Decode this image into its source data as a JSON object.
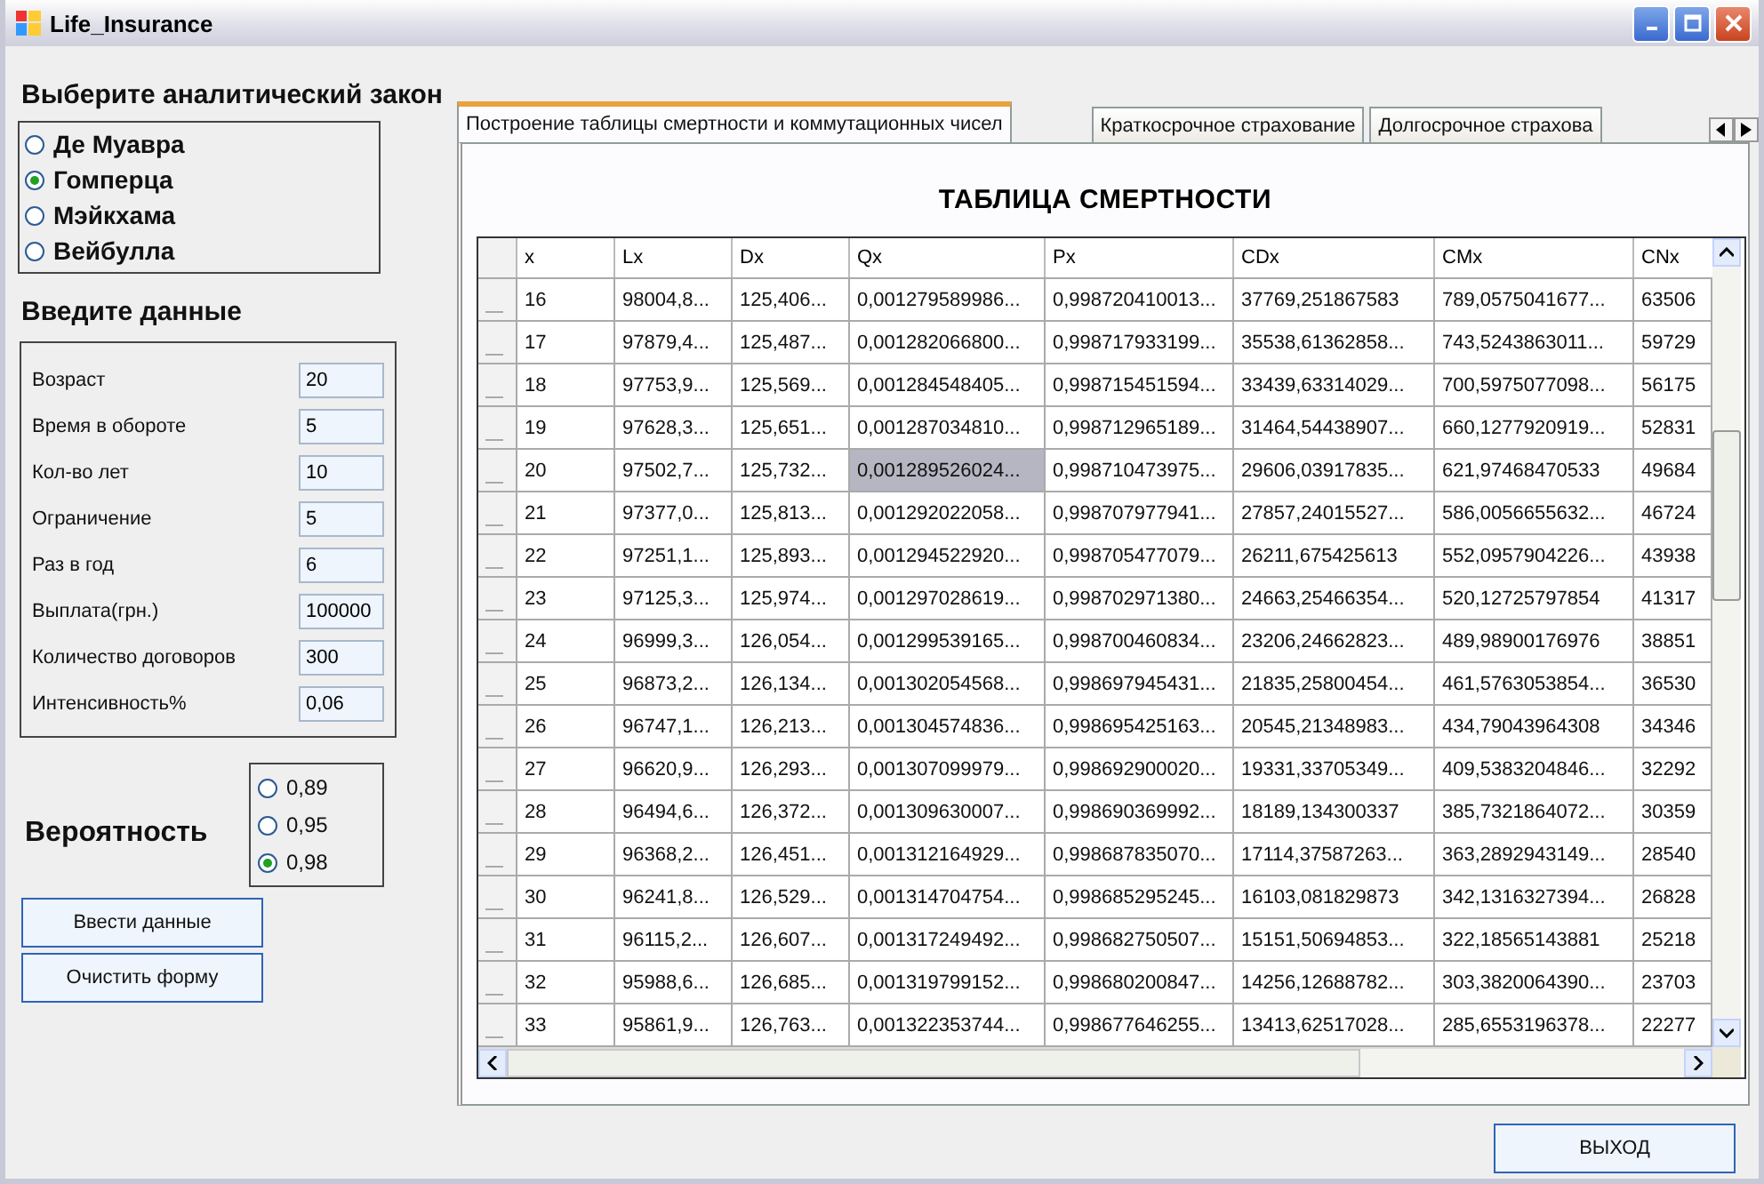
{
  "window": {
    "title": "Life_Insurance"
  },
  "law": {
    "heading": "Выберите аналитический закон",
    "options": [
      {
        "label": "Де Муавра",
        "selected": false
      },
      {
        "label": "Гомперца",
        "selected": true
      },
      {
        "label": "Мэйкхама",
        "selected": false
      },
      {
        "label": "Вейбулла",
        "selected": false
      }
    ]
  },
  "inputs": {
    "heading": "Введите данные",
    "fields": [
      {
        "label": "Возраст",
        "value": "20"
      },
      {
        "label": "Время в обороте",
        "value": "5"
      },
      {
        "label": "Кол-во лет",
        "value": "10"
      },
      {
        "label": "Ограничение",
        "value": "5"
      },
      {
        "label": "Раз в год",
        "value": "6"
      },
      {
        "label": "Выплата(грн.)",
        "value": "100000"
      },
      {
        "label": "Количество договоров",
        "value": "300"
      },
      {
        "label": "Интенсивность%",
        "value": "0,06"
      }
    ]
  },
  "probability": {
    "label": "Вероятность",
    "options": [
      {
        "label": "0,89",
        "selected": false
      },
      {
        "label": "0,95",
        "selected": false
      },
      {
        "label": "0,98",
        "selected": true
      }
    ]
  },
  "buttons": [
    "Ввести данные",
    "Очистить форму"
  ],
  "tabs": [
    {
      "label": "Построение таблицы смертности и коммутационных чисел",
      "selected": true
    },
    {
      "label": "Краткосрочное страхование",
      "selected": false
    },
    {
      "label": "Долгосрочное страхова",
      "selected": false
    }
  ],
  "table": {
    "title": "ТАБЛИЦА СМЕРТНОСТИ",
    "columns": [
      "x",
      "Lx",
      "Dx",
      "Qx",
      "Px",
      "CDx",
      "CMx",
      "CNx"
    ],
    "rows": [
      {
        "cells": [
          {
            "text": "16",
            "selected": false
          },
          {
            "text": "98004,8...",
            "selected": false
          },
          {
            "text": "125,406...",
            "selected": false
          },
          {
            "text": "0,001279589986...",
            "selected": false
          },
          {
            "text": "0,998720410013...",
            "selected": false
          },
          {
            "text": "37769,251867583",
            "selected": false
          },
          {
            "text": "789,0575041677...",
            "selected": false
          },
          {
            "text": "63506",
            "selected": false
          }
        ]
      },
      {
        "cells": [
          {
            "text": "17",
            "selected": false
          },
          {
            "text": "97879,4...",
            "selected": false
          },
          {
            "text": "125,487...",
            "selected": false
          },
          {
            "text": "0,001282066800...",
            "selected": false
          },
          {
            "text": "0,998717933199...",
            "selected": false
          },
          {
            "text": "35538,61362858...",
            "selected": false
          },
          {
            "text": "743,5243863011...",
            "selected": false
          },
          {
            "text": "59729",
            "selected": false
          }
        ]
      },
      {
        "cells": [
          {
            "text": "18",
            "selected": false
          },
          {
            "text": "97753,9...",
            "selected": false
          },
          {
            "text": "125,569...",
            "selected": false
          },
          {
            "text": "0,001284548405...",
            "selected": false
          },
          {
            "text": "0,998715451594...",
            "selected": false
          },
          {
            "text": "33439,63314029...",
            "selected": false
          },
          {
            "text": "700,5975077098...",
            "selected": false
          },
          {
            "text": "56175",
            "selected": false
          }
        ]
      },
      {
        "cells": [
          {
            "text": "19",
            "selected": false
          },
          {
            "text": "97628,3...",
            "selected": false
          },
          {
            "text": "125,651...",
            "selected": false
          },
          {
            "text": "0,001287034810...",
            "selected": false
          },
          {
            "text": "0,998712965189...",
            "selected": false
          },
          {
            "text": "31464,54438907...",
            "selected": false
          },
          {
            "text": "660,1277920919...",
            "selected": false
          },
          {
            "text": "52831",
            "selected": false
          }
        ]
      },
      {
        "cells": [
          {
            "text": "20",
            "selected": false
          },
          {
            "text": "97502,7...",
            "selected": false
          },
          {
            "text": "125,732...",
            "selected": false
          },
          {
            "text": "0,001289526024...",
            "selected": true
          },
          {
            "text": "0,998710473975...",
            "selected": false
          },
          {
            "text": "29606,03917835...",
            "selected": false
          },
          {
            "text": "621,97468470533",
            "selected": false
          },
          {
            "text": "49684",
            "selected": false
          }
        ]
      },
      {
        "cells": [
          {
            "text": "21",
            "selected": false
          },
          {
            "text": "97377,0...",
            "selected": false
          },
          {
            "text": "125,813...",
            "selected": false
          },
          {
            "text": "0,001292022058...",
            "selected": false
          },
          {
            "text": "0,998707977941...",
            "selected": false
          },
          {
            "text": "27857,24015527...",
            "selected": false
          },
          {
            "text": "586,0056655632...",
            "selected": false
          },
          {
            "text": "46724",
            "selected": false
          }
        ]
      },
      {
        "cells": [
          {
            "text": "22",
            "selected": false
          },
          {
            "text": "97251,1...",
            "selected": false
          },
          {
            "text": "125,893...",
            "selected": false
          },
          {
            "text": "0,001294522920...",
            "selected": false
          },
          {
            "text": "0,998705477079...",
            "selected": false
          },
          {
            "text": "26211,675425613",
            "selected": false
          },
          {
            "text": "552,0957904226...",
            "selected": false
          },
          {
            "text": "43938",
            "selected": false
          }
        ]
      },
      {
        "cells": [
          {
            "text": "23",
            "selected": false
          },
          {
            "text": "97125,3...",
            "selected": false
          },
          {
            "text": "125,974...",
            "selected": false
          },
          {
            "text": "0,001297028619...",
            "selected": false
          },
          {
            "text": "0,998702971380...",
            "selected": false
          },
          {
            "text": "24663,25466354...",
            "selected": false
          },
          {
            "text": "520,12725797854",
            "selected": false
          },
          {
            "text": "41317",
            "selected": false
          }
        ]
      },
      {
        "cells": [
          {
            "text": "24",
            "selected": false
          },
          {
            "text": "96999,3...",
            "selected": false
          },
          {
            "text": "126,054...",
            "selected": false
          },
          {
            "text": "0,001299539165...",
            "selected": false
          },
          {
            "text": "0,998700460834...",
            "selected": false
          },
          {
            "text": "23206,24662823...",
            "selected": false
          },
          {
            "text": "489,98900176976",
            "selected": false
          },
          {
            "text": "38851",
            "selected": false
          }
        ]
      },
      {
        "cells": [
          {
            "text": "25",
            "selected": false
          },
          {
            "text": "96873,2...",
            "selected": false
          },
          {
            "text": "126,134...",
            "selected": false
          },
          {
            "text": "0,001302054568...",
            "selected": false
          },
          {
            "text": "0,998697945431...",
            "selected": false
          },
          {
            "text": "21835,25800454...",
            "selected": false
          },
          {
            "text": "461,5763053854...",
            "selected": false
          },
          {
            "text": "36530",
            "selected": false
          }
        ]
      },
      {
        "cells": [
          {
            "text": "26",
            "selected": false
          },
          {
            "text": "96747,1...",
            "selected": false
          },
          {
            "text": "126,213...",
            "selected": false
          },
          {
            "text": "0,001304574836...",
            "selected": false
          },
          {
            "text": "0,998695425163...",
            "selected": false
          },
          {
            "text": "20545,21348983...",
            "selected": false
          },
          {
            "text": "434,79043964308",
            "selected": false
          },
          {
            "text": "34346",
            "selected": false
          }
        ]
      },
      {
        "cells": [
          {
            "text": "27",
            "selected": false
          },
          {
            "text": "96620,9...",
            "selected": false
          },
          {
            "text": "126,293...",
            "selected": false
          },
          {
            "text": "0,001307099979...",
            "selected": false
          },
          {
            "text": "0,998692900020...",
            "selected": false
          },
          {
            "text": "19331,33705349...",
            "selected": false
          },
          {
            "text": "409,5383204846...",
            "selected": false
          },
          {
            "text": "32292",
            "selected": false
          }
        ]
      },
      {
        "cells": [
          {
            "text": "28",
            "selected": false
          },
          {
            "text": "96494,6...",
            "selected": false
          },
          {
            "text": "126,372...",
            "selected": false
          },
          {
            "text": "0,001309630007...",
            "selected": false
          },
          {
            "text": "0,998690369992...",
            "selected": false
          },
          {
            "text": "18189,134300337",
            "selected": false
          },
          {
            "text": "385,7321864072...",
            "selected": false
          },
          {
            "text": "30359",
            "selected": false
          }
        ]
      },
      {
        "cells": [
          {
            "text": "29",
            "selected": false
          },
          {
            "text": "96368,2...",
            "selected": false
          },
          {
            "text": "126,451...",
            "selected": false
          },
          {
            "text": "0,001312164929...",
            "selected": false
          },
          {
            "text": "0,998687835070...",
            "selected": false
          },
          {
            "text": "17114,37587263...",
            "selected": false
          },
          {
            "text": "363,2892943149...",
            "selected": false
          },
          {
            "text": "28540",
            "selected": false
          }
        ]
      },
      {
        "cells": [
          {
            "text": "30",
            "selected": false
          },
          {
            "text": "96241,8...",
            "selected": false
          },
          {
            "text": "126,529...",
            "selected": false
          },
          {
            "text": "0,001314704754...",
            "selected": false
          },
          {
            "text": "0,998685295245...",
            "selected": false
          },
          {
            "text": "16103,081829873",
            "selected": false
          },
          {
            "text": "342,1316327394...",
            "selected": false
          },
          {
            "text": "26828",
            "selected": false
          }
        ]
      },
      {
        "cells": [
          {
            "text": "31",
            "selected": false
          },
          {
            "text": "96115,2...",
            "selected": false
          },
          {
            "text": "126,607...",
            "selected": false
          },
          {
            "text": "0,001317249492...",
            "selected": false
          },
          {
            "text": "0,998682750507...",
            "selected": false
          },
          {
            "text": "15151,50694853...",
            "selected": false
          },
          {
            "text": "322,18565143881",
            "selected": false
          },
          {
            "text": "25218",
            "selected": false
          }
        ]
      },
      {
        "cells": [
          {
            "text": "32",
            "selected": false
          },
          {
            "text": "95988,6...",
            "selected": false
          },
          {
            "text": "126,685...",
            "selected": false
          },
          {
            "text": "0,001319799152...",
            "selected": false
          },
          {
            "text": "0,998680200847...",
            "selected": false
          },
          {
            "text": "14256,12688782...",
            "selected": false
          },
          {
            "text": "303,3820064390...",
            "selected": false
          },
          {
            "text": "23703",
            "selected": false
          }
        ]
      },
      {
        "cells": [
          {
            "text": "33",
            "selected": false
          },
          {
            "text": "95861,9...",
            "selected": false
          },
          {
            "text": "126,763...",
            "selected": false
          },
          {
            "text": "0,001322353744...",
            "selected": false
          },
          {
            "text": "0,998677646255...",
            "selected": false
          },
          {
            "text": "13413,62517028...",
            "selected": false
          },
          {
            "text": "285,6553196378...",
            "selected": false
          },
          {
            "text": "22277",
            "selected": false
          }
        ]
      }
    ]
  },
  "exit_button": "ВЫХОД"
}
